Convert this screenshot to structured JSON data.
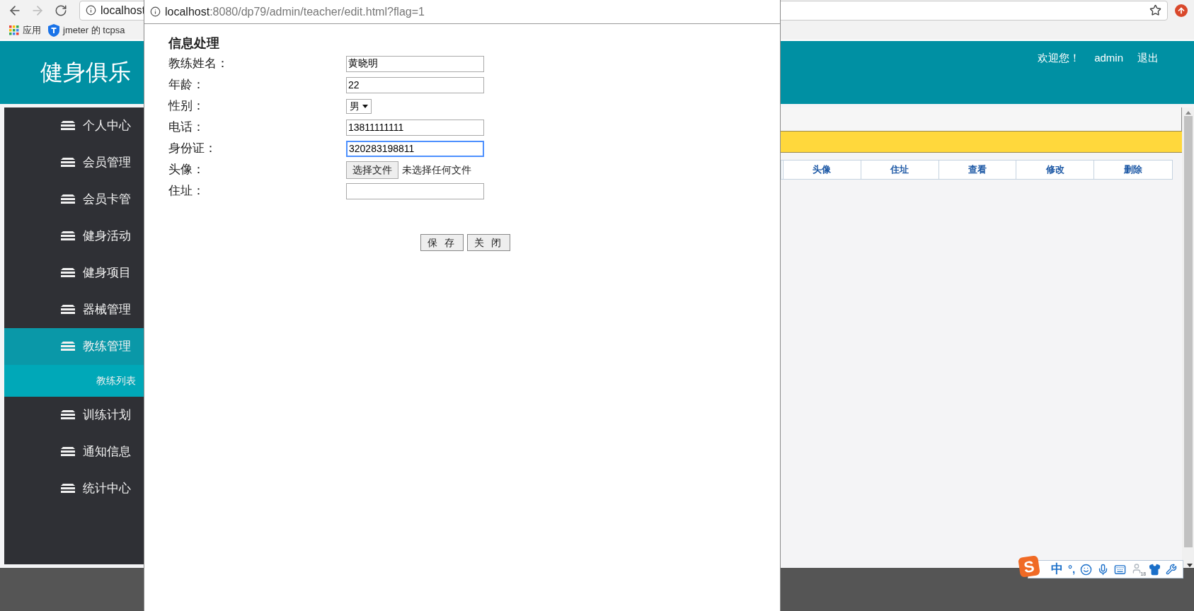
{
  "browser": {
    "address": "localhost",
    "bookmarks": [
      {
        "kind": "apps",
        "label": "应用"
      },
      {
        "kind": "shield",
        "label": "jmeter 的 tcpsa"
      }
    ]
  },
  "header": {
    "title": "健身俱乐",
    "welcome": "欢迎您！",
    "user": "admin",
    "logout": "退出"
  },
  "sidebar": {
    "items": [
      {
        "label": "个人中心",
        "selected": false
      },
      {
        "label": "会员管理",
        "selected": false
      },
      {
        "label": "会员卡管",
        "selected": false
      },
      {
        "label": "健身活动",
        "selected": false
      },
      {
        "label": "健身项目",
        "selected": false
      },
      {
        "label": "器械管理",
        "selected": false
      },
      {
        "label": "教练管理",
        "selected": true,
        "children": [
          {
            "label": "教练列表",
            "selected": true
          }
        ]
      },
      {
        "label": "训练计划",
        "selected": false
      },
      {
        "label": "通知信息",
        "selected": false
      },
      {
        "label": "统计中心",
        "selected": false
      }
    ]
  },
  "table": {
    "columns": [
      "头像",
      "住址",
      "查看",
      "修改",
      "删除"
    ]
  },
  "popup": {
    "url_host": "localhost",
    "url_path": ":8080/dp79/admin/teacher/edit.html?flag=1",
    "title": "信息处理",
    "fields": [
      {
        "label": "教练姓名：",
        "kind": "text",
        "value": "黄晓明",
        "focused": false
      },
      {
        "label": "年龄：",
        "kind": "text",
        "value": "22",
        "focused": false
      },
      {
        "label": "性别：",
        "kind": "select",
        "value": "男"
      },
      {
        "label": "电话：",
        "kind": "text",
        "value": "13811111111",
        "focused": false
      },
      {
        "label": "身份证：",
        "kind": "text",
        "value": "320283198811",
        "focused": true
      },
      {
        "label": "头像：",
        "kind": "file",
        "button": "选择文件",
        "value": "未选择任何文件"
      },
      {
        "label": "住址：",
        "kind": "text",
        "focused": false
      }
    ],
    "buttons": [
      "保 存",
      "关 闭"
    ]
  },
  "ime": {
    "logo": "S",
    "mode": "中",
    "punct": "°,",
    "badge": "18"
  }
}
